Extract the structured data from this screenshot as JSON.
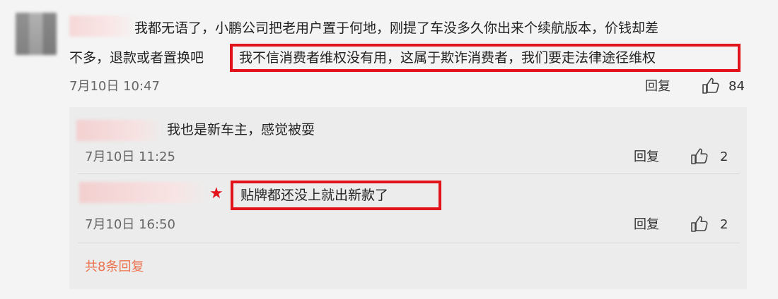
{
  "main_comment": {
    "line1": "我都无语了，小鹏公司把老用户置于何地，刚提了车没多久你出来个续航版本，价钱却差",
    "line2_start": "不多，退款或者置换吧",
    "highlighted": "我不信消费者维权没有用，这属于欺诈消费者，我们要走法律途径维权",
    "time": "7月10日 10:47",
    "reply_label": "回复",
    "likes": "84"
  },
  "replies": [
    {
      "text": "我也是新车主，感觉被耍",
      "time": "7月10日 11:25",
      "reply_label": "回复",
      "likes": "2"
    },
    {
      "text": "贴牌都还没上就出新款了",
      "time": "7月10日 16:50",
      "reply_label": "回复",
      "likes": "2"
    }
  ],
  "more_replies": "共8条回复",
  "colors": {
    "highlight_box": "#e3131b",
    "link": "#eb7350",
    "panel": "#ececec"
  }
}
